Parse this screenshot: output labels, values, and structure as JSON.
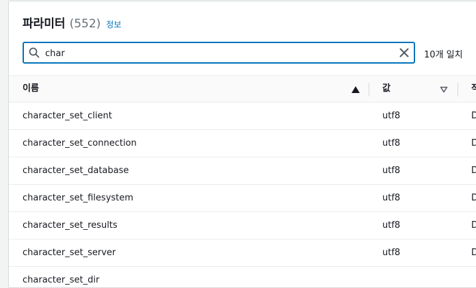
{
  "header": {
    "title": "파라미터",
    "count": "(552)",
    "info_label": "정보"
  },
  "search": {
    "value": "char",
    "placeholder": "",
    "match_count": "10개 일치"
  },
  "table": {
    "columns": [
      "이름",
      "값",
      "적"
    ],
    "sort": {
      "column": "이름",
      "direction": "ascending"
    },
    "rows": [
      {
        "name": "character_set_client",
        "value": "utf8",
        "col3": "D"
      },
      {
        "name": "character_set_connection",
        "value": "utf8",
        "col3": "D"
      },
      {
        "name": "character_set_database",
        "value": "utf8",
        "col3": "D"
      },
      {
        "name": "character_set_filesystem",
        "value": "utf8",
        "col3": "D"
      },
      {
        "name": "character_set_results",
        "value": "utf8",
        "col3": "D"
      },
      {
        "name": "character_set_server",
        "value": "utf8",
        "col3": "D"
      },
      {
        "name": "character_set_dir",
        "value": "",
        "col3": ""
      }
    ]
  },
  "colors": {
    "accent": "#0073bb",
    "text": "#16191f",
    "muted": "#687078",
    "border": "#eaeded"
  }
}
